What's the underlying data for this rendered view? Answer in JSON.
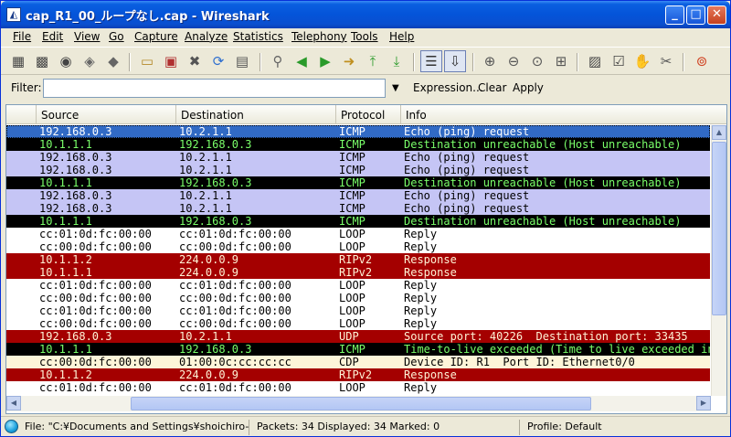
{
  "window": {
    "title": "cap_R1_00_ループなし.cap - Wireshark",
    "app_icon": "wireshark-fin-icon",
    "controls": {
      "minimize": "_",
      "maximize": "□",
      "close": "✕"
    }
  },
  "menu": [
    "File",
    "Edit",
    "View",
    "Go",
    "Capture",
    "Analyze",
    "Statistics",
    "Telephony",
    "Tools",
    "Help"
  ],
  "toolbar": {
    "icons": [
      "interface-list-icon",
      "capture-options-icon",
      "start-capture-icon",
      "stop-capture-icon",
      "restart-capture-icon",
      "open-file-icon",
      "save-file-icon",
      "close-file-icon",
      "reload-icon",
      "print-icon",
      "find-packet-icon",
      "go-back-icon",
      "go-forward-icon",
      "go-to-packet-icon",
      "go-first-icon",
      "go-last-icon",
      "colorize-icon",
      "auto-scroll-icon",
      "zoom-in-icon",
      "zoom-out-icon",
      "normal-size-icon",
      "resize-columns-icon",
      "capture-filters-icon",
      "display-filters-icon",
      "coloring-rules-icon",
      "preferences-icon",
      "help-icon"
    ]
  },
  "filter": {
    "label": "Filter:",
    "value": "",
    "expression": "Expression...",
    "clear": "Clear",
    "apply": "Apply"
  },
  "packet_list": {
    "columns": [
      "Source",
      "Destination",
      "Protocol",
      "Info"
    ],
    "colors": {
      "icmp_request": {
        "bg": "#c5c5f5",
        "fg": "#000000"
      },
      "icmp_error": {
        "bg": "#000000",
        "fg": "#7aff6a"
      },
      "loop": {
        "bg": "#ffffff",
        "fg": "#000000"
      },
      "rip": {
        "bg": "#a40000",
        "fg": "#fff3d6"
      },
      "udp": {
        "bg": "#a40000",
        "fg": "#fff3d6"
      },
      "cdp": {
        "bg": "#fdf5d9",
        "fg": "#000000"
      },
      "selected": {
        "bg": "#316ac5",
        "fg": "#ffffff"
      }
    },
    "rows": [
      {
        "source": "192.168.0.3",
        "destination": "10.2.1.1",
        "protocol": "ICMP",
        "info": "Echo (ping) request",
        "color": "selected"
      },
      {
        "source": "10.1.1.1",
        "destination": "192.168.0.3",
        "protocol": "ICMP",
        "info": "Destination unreachable (Host unreachable)",
        "color": "icmp_error"
      },
      {
        "source": "192.168.0.3",
        "destination": "10.2.1.1",
        "protocol": "ICMP",
        "info": "Echo (ping) request",
        "color": "icmp_request"
      },
      {
        "source": "192.168.0.3",
        "destination": "10.2.1.1",
        "protocol": "ICMP",
        "info": "Echo (ping) request",
        "color": "icmp_request"
      },
      {
        "source": "10.1.1.1",
        "destination": "192.168.0.3",
        "protocol": "ICMP",
        "info": "Destination unreachable (Host unreachable)",
        "color": "icmp_error"
      },
      {
        "source": "192.168.0.3",
        "destination": "10.2.1.1",
        "protocol": "ICMP",
        "info": "Echo (ping) request",
        "color": "icmp_request"
      },
      {
        "source": "192.168.0.3",
        "destination": "10.2.1.1",
        "protocol": "ICMP",
        "info": "Echo (ping) request",
        "color": "icmp_request"
      },
      {
        "source": "10.1.1.1",
        "destination": "192.168.0.3",
        "protocol": "ICMP",
        "info": "Destination unreachable (Host unreachable)",
        "color": "icmp_error"
      },
      {
        "source": "cc:01:0d:fc:00:00",
        "destination": "cc:01:0d:fc:00:00",
        "protocol": "LOOP",
        "info": "Reply",
        "color": "loop"
      },
      {
        "source": "cc:00:0d:fc:00:00",
        "destination": "cc:00:0d:fc:00:00",
        "protocol": "LOOP",
        "info": "Reply",
        "color": "loop"
      },
      {
        "source": "10.1.1.2",
        "destination": "224.0.0.9",
        "protocol": "RIPv2",
        "info": "Response",
        "color": "rip"
      },
      {
        "source": "10.1.1.1",
        "destination": "224.0.0.9",
        "protocol": "RIPv2",
        "info": "Response",
        "color": "rip"
      },
      {
        "source": "cc:01:0d:fc:00:00",
        "destination": "cc:01:0d:fc:00:00",
        "protocol": "LOOP",
        "info": "Reply",
        "color": "loop"
      },
      {
        "source": "cc:00:0d:fc:00:00",
        "destination": "cc:00:0d:fc:00:00",
        "protocol": "LOOP",
        "info": "Reply",
        "color": "loop"
      },
      {
        "source": "cc:01:0d:fc:00:00",
        "destination": "cc:01:0d:fc:00:00",
        "protocol": "LOOP",
        "info": "Reply",
        "color": "loop"
      },
      {
        "source": "cc:00:0d:fc:00:00",
        "destination": "cc:00:0d:fc:00:00",
        "protocol": "LOOP",
        "info": "Reply",
        "color": "loop"
      },
      {
        "source": "192.168.0.3",
        "destination": "10.2.1.1",
        "protocol": "UDP",
        "info": "Source port: 40226  Destination port: 33435",
        "color": "udp"
      },
      {
        "source": "10.1.1.1",
        "destination": "192.168.0.3",
        "protocol": "ICMP",
        "info": "Time-to-live exceeded (Time to live exceeded in transit)",
        "color": "icmp_error"
      },
      {
        "source": "cc:00:0d:fc:00:00",
        "destination": "01:00:0c:cc:cc:cc",
        "protocol": "CDP",
        "info": "Device ID: R1  Port ID: Ethernet0/0",
        "color": "cdp"
      },
      {
        "source": "10.1.1.2",
        "destination": "224.0.0.9",
        "protocol": "RIPv2",
        "info": "Response",
        "color": "rip"
      },
      {
        "source": "cc:01:0d:fc:00:00",
        "destination": "cc:01:0d:fc:00:00",
        "protocol": "LOOP",
        "info": "Reply",
        "color": "loop"
      }
    ]
  },
  "status": {
    "icon": "expert-info-icon",
    "file": "File: \"C:¥Documents and Settings¥shoichiro-…",
    "packets": "Packets: 34 Displayed: 34 Marked: 0",
    "profile": "Profile: Default"
  }
}
